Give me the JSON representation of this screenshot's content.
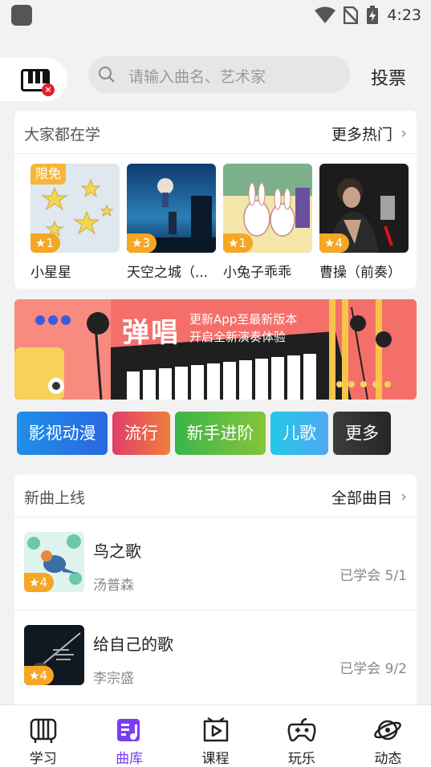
{
  "status": {
    "time": "4:23"
  },
  "header": {
    "search_placeholder": "请输入曲名、艺术家",
    "vote_label": "投票",
    "badge": "×"
  },
  "hot": {
    "title": "大家都在学",
    "more_label": "更多热门",
    "chevron": "›",
    "items": [
      {
        "name": "小星星",
        "stars": "★1",
        "tag": "限免"
      },
      {
        "name": "天空之城（...",
        "stars": "★3"
      },
      {
        "name": "小兔子乖乖",
        "stars": "★1"
      },
      {
        "name": "曹操（前奏）",
        "stars": "★4"
      }
    ]
  },
  "banner": {
    "title": "弹唱",
    "line1": "更新App至最新版本",
    "line2": "开启全新演奏体验"
  },
  "categories": [
    {
      "label": "影视动漫",
      "color_start": "#1f8fe8",
      "color_end": "#2a68e0"
    },
    {
      "label": "流行",
      "color_start": "#e23d6c",
      "color_end": "#ef7f3a"
    },
    {
      "label": "新手进阶",
      "color_start": "#3bb54a",
      "color_end": "#86c43a"
    },
    {
      "label": "儿歌",
      "color_start": "#21c8e6",
      "color_end": "#4fa8f2"
    },
    {
      "label": "更多",
      "color_start": "#3c3c3c",
      "color_end": "#262626"
    }
  ],
  "new_songs": {
    "title": "新曲上线",
    "more_label": "全部曲目",
    "chevron": "›",
    "items": [
      {
        "title": "鸟之歌",
        "artist": "汤普森",
        "progress": "已学会 5/1",
        "stars": "★4"
      },
      {
        "title": "给自己的歌",
        "artist": "李宗盛",
        "progress": "已学会 9/2",
        "stars": "★4"
      }
    ]
  },
  "tabs": [
    {
      "label": "学习",
      "icon": "piano-icon"
    },
    {
      "label": "曲库",
      "icon": "music-library-icon",
      "active": true
    },
    {
      "label": "课程",
      "icon": "course-play-icon"
    },
    {
      "label": "玩乐",
      "icon": "gamepad-icon"
    },
    {
      "label": "动态",
      "icon": "planet-icon"
    }
  ],
  "colors": {
    "accent": "#7a3ef0",
    "star_badge": "#f5a623",
    "banner_bg": "#f56f6a"
  }
}
